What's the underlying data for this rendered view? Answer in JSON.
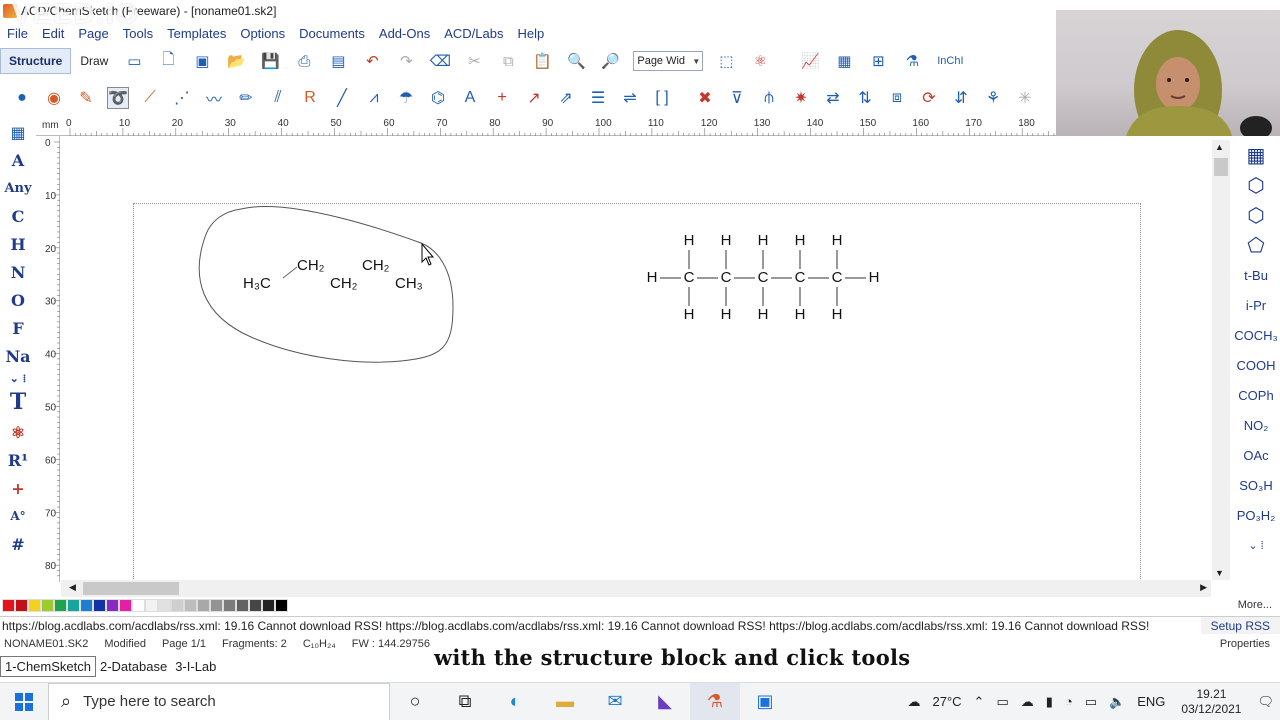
{
  "window": {
    "title": "ACD/ChemSketch (Freeware) - [noname01.sk2]",
    "watermark": "VEED.IO"
  },
  "menu": [
    "File",
    "Edit",
    "Page",
    "Tools",
    "Templates",
    "Options",
    "Documents",
    "Add-Ons",
    "ACD/Labs",
    "Help"
  ],
  "toolbar": {
    "mode_structure": "Structure",
    "mode_draw": "Draw",
    "zoom_value": "Page Wid"
  },
  "left_palette": [
    "A",
    "Any",
    "C",
    "H",
    "N",
    "O",
    "F",
    "Na",
    "T",
    "R¹",
    "+",
    "#"
  ],
  "right_palette": [
    "t-Bu",
    "i-Pr",
    "COCH₃",
    "COOH",
    "COPh",
    "NO₂",
    "OAc",
    "SO₃H",
    "PO₃H₂"
  ],
  "ruler": {
    "unit": "mm",
    "h_ticks": [
      "0",
      "10",
      "20",
      "30",
      "40",
      "50",
      "60",
      "70",
      "80",
      "90",
      "100",
      "110",
      "120",
      "130",
      "140",
      "150",
      "160",
      "170",
      "180"
    ],
    "v_ticks": [
      "0",
      "10",
      "20",
      "30",
      "40",
      "50",
      "60",
      "70",
      "80"
    ]
  },
  "structure_left": {
    "labels": [
      "H₃C",
      "CH₂",
      "CH₂",
      "CH₂",
      "CH₃"
    ]
  },
  "structure_right": {
    "carbon": "C",
    "hydrogen": "H"
  },
  "colors": [
    "#e3141b",
    "#c0111a",
    "#f3d11d",
    "#9ecb2a",
    "#1ea44a",
    "#17a59d",
    "#1e7fd0",
    "#1432a8",
    "#8a2ac4",
    "#e41ea6",
    "#ffffff",
    "#f2f2f2",
    "#e1e1e1",
    "#cfcfcf",
    "#bdbdbd",
    "#a8a8a8",
    "#939393",
    "#7b7b7b",
    "#626262",
    "#464646",
    "#232323",
    "#000000"
  ],
  "more_label": "More...",
  "rss": {
    "text": "https://blog.acdlabs.com/acdlabs/rss.xml: 19.16 Cannot download RSS! https://blog.acdlabs.com/acdlabs/rss.xml: 19.16 Cannot download RSS! https://blog.acdlabs.com/acdlabs/rss.xml: 19.16 Cannot download RSS!",
    "setup": "Setup RSS"
  },
  "status": {
    "file": "NONAME01.SK2",
    "modified": "Modified",
    "page": "Page 1/1",
    "fragments": "Fragments: 2",
    "formula": "C₁₀H₂₄",
    "fw": "FW : 144.29756",
    "properties": "Properties"
  },
  "tabs": [
    "1-ChemSketch",
    "2-Database",
    "3-I-Lab"
  ],
  "caption": "with the structure block and click tools",
  "taskbar": {
    "search_placeholder": "Type here to search",
    "temperature": "27°C",
    "lang": "ENG",
    "time": "19.21",
    "date": "03/12/2021"
  }
}
